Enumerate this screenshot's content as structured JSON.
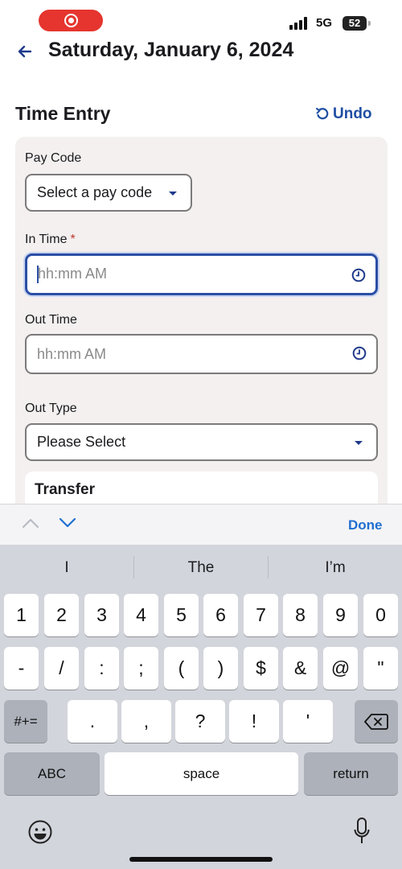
{
  "status_bar": {
    "network": "5G",
    "battery": "52"
  },
  "header": {
    "title": "Saturday, January 6, 2024"
  },
  "section": {
    "title": "Time Entry",
    "undo_label": "Undo"
  },
  "form": {
    "pay_code": {
      "label": "Pay Code",
      "value": "Select a pay code"
    },
    "in_time": {
      "label": "In Time",
      "required_mark": "*",
      "placeholder": "hh:mm AM"
    },
    "out_time": {
      "label": "Out Time",
      "placeholder": "hh:mm AM"
    },
    "out_type": {
      "label": "Out Type",
      "value": "Please Select"
    },
    "transfer": {
      "title": "Transfer"
    }
  },
  "accessory_bar": {
    "done_label": "Done"
  },
  "keyboard": {
    "suggestions": [
      "I",
      "The",
      "I’m"
    ],
    "row1": [
      "1",
      "2",
      "3",
      "4",
      "5",
      "6",
      "7",
      "8",
      "9",
      "0"
    ],
    "row2": [
      "-",
      "/",
      ":",
      ";",
      "(",
      ")",
      "$",
      "&",
      "@",
      "\""
    ],
    "row3": [
      ".",
      ",",
      "?",
      "!",
      "'"
    ],
    "symbols_key": "#+=",
    "abc_key": "ABC",
    "space_key": "space",
    "return_key": "return"
  }
}
